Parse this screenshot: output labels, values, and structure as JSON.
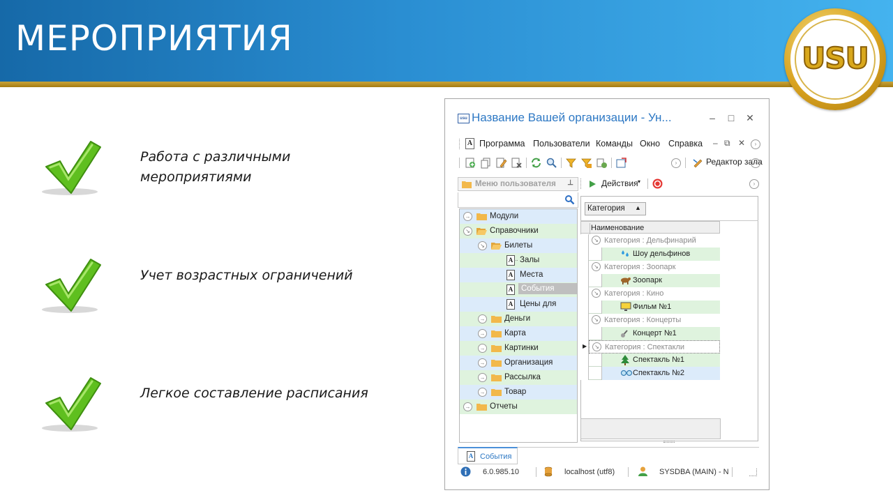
{
  "slide": {
    "title": "МЕРОПРИЯТИЯ",
    "logo_text": "USU",
    "features": [
      "Работа с различными мероприятиями",
      "Учет возрастных ограничений",
      "Легкое составление расписания"
    ]
  },
  "window": {
    "title": "Название Вашей организации - Ун...",
    "title_icon": "usu",
    "menu": [
      "Программа",
      "Пользователи",
      "Команды",
      "Окно",
      "Справка"
    ],
    "toolbar_editor": "Редактор зала",
    "tree_panel_title": "Меню пользователя",
    "tree": [
      {
        "label": "Модули",
        "level": 0
      },
      {
        "label": "Справочники",
        "level": 0
      },
      {
        "label": "Билеты",
        "level": 1
      },
      {
        "label": "Залы",
        "level": 2
      },
      {
        "label": "Места",
        "level": 2
      },
      {
        "label": "События",
        "level": 2,
        "selected": true
      },
      {
        "label": "Цены для",
        "level": 2
      },
      {
        "label": "Деньги",
        "level": 1
      },
      {
        "label": "Карта",
        "level": 1
      },
      {
        "label": "Картинки",
        "level": 1
      },
      {
        "label": "Организация",
        "level": 1
      },
      {
        "label": "Рассылка",
        "level": 1
      },
      {
        "label": "Товар",
        "level": 1
      },
      {
        "label": "Отчеты",
        "level": 0
      }
    ],
    "actions_label": "Действия",
    "group_button": "Категория",
    "grid_header": "Наименование",
    "grid": [
      {
        "type": "group",
        "text": "Категория : Дельфинарий"
      },
      {
        "type": "item",
        "text": "Шоу дельфинов",
        "icon": "water-drops-icon"
      },
      {
        "type": "group",
        "text": "Категория : Зоопарк"
      },
      {
        "type": "item",
        "text": "Зоопарк",
        "icon": "animal-icon"
      },
      {
        "type": "group",
        "text": "Категория : Кино"
      },
      {
        "type": "item",
        "text": "Фильм №1",
        "icon": "monitor-icon"
      },
      {
        "type": "group",
        "text": "Категория : Концерты"
      },
      {
        "type": "item",
        "text": "Концерт №1",
        "icon": "guitar-icon"
      },
      {
        "type": "group",
        "text": "Категория : Спектакли"
      },
      {
        "type": "item",
        "text": "Спектакль №1",
        "icon": "tree-icon"
      },
      {
        "type": "item",
        "text": "Спектакль №2",
        "icon": "glasses-icon"
      }
    ],
    "tab_label": "События",
    "status": {
      "version": "6.0.985.10",
      "server": "localhost (utf8)",
      "user": "SYSDBA (MAIN) - N"
    }
  },
  "colors": {
    "banner_start": "#1669a8",
    "banner_end": "#44b3ef",
    "gold": "#c9a43a",
    "check_green": "#5fbf1f",
    "window_title": "#2d78c4",
    "row_blue": "#dcebfa",
    "row_green": "#dff3de"
  }
}
